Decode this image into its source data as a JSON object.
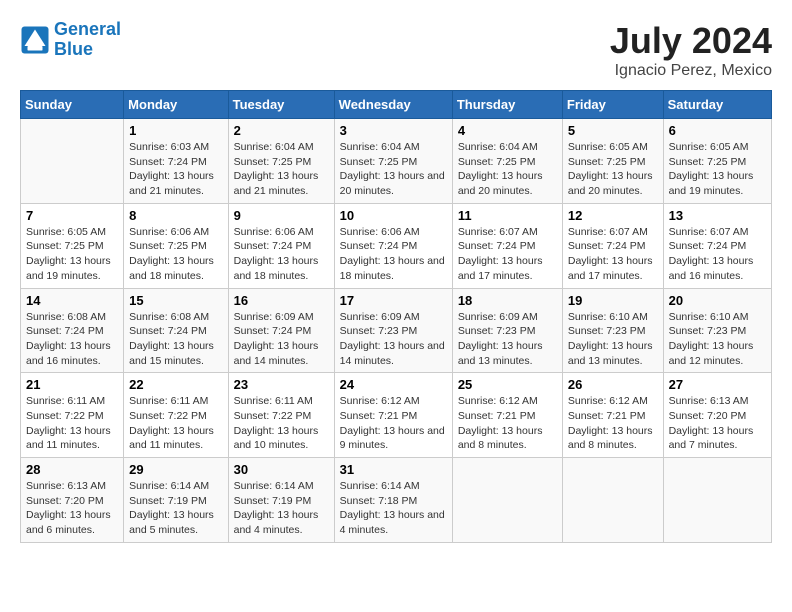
{
  "header": {
    "logo_line1": "General",
    "logo_line2": "Blue",
    "month_year": "July 2024",
    "location": "Ignacio Perez, Mexico"
  },
  "weekdays": [
    "Sunday",
    "Monday",
    "Tuesday",
    "Wednesday",
    "Thursday",
    "Friday",
    "Saturday"
  ],
  "weeks": [
    [
      {
        "day": "",
        "sunrise": "",
        "sunset": "",
        "daylight": ""
      },
      {
        "day": "1",
        "sunrise": "Sunrise: 6:03 AM",
        "sunset": "Sunset: 7:24 PM",
        "daylight": "Daylight: 13 hours and 21 minutes."
      },
      {
        "day": "2",
        "sunrise": "Sunrise: 6:04 AM",
        "sunset": "Sunset: 7:25 PM",
        "daylight": "Daylight: 13 hours and 21 minutes."
      },
      {
        "day": "3",
        "sunrise": "Sunrise: 6:04 AM",
        "sunset": "Sunset: 7:25 PM",
        "daylight": "Daylight: 13 hours and 20 minutes."
      },
      {
        "day": "4",
        "sunrise": "Sunrise: 6:04 AM",
        "sunset": "Sunset: 7:25 PM",
        "daylight": "Daylight: 13 hours and 20 minutes."
      },
      {
        "day": "5",
        "sunrise": "Sunrise: 6:05 AM",
        "sunset": "Sunset: 7:25 PM",
        "daylight": "Daylight: 13 hours and 20 minutes."
      },
      {
        "day": "6",
        "sunrise": "Sunrise: 6:05 AM",
        "sunset": "Sunset: 7:25 PM",
        "daylight": "Daylight: 13 hours and 19 minutes."
      }
    ],
    [
      {
        "day": "7",
        "sunrise": "Sunrise: 6:05 AM",
        "sunset": "Sunset: 7:25 PM",
        "daylight": "Daylight: 13 hours and 19 minutes."
      },
      {
        "day": "8",
        "sunrise": "Sunrise: 6:06 AM",
        "sunset": "Sunset: 7:25 PM",
        "daylight": "Daylight: 13 hours and 18 minutes."
      },
      {
        "day": "9",
        "sunrise": "Sunrise: 6:06 AM",
        "sunset": "Sunset: 7:24 PM",
        "daylight": "Daylight: 13 hours and 18 minutes."
      },
      {
        "day": "10",
        "sunrise": "Sunrise: 6:06 AM",
        "sunset": "Sunset: 7:24 PM",
        "daylight": "Daylight: 13 hours and 18 minutes."
      },
      {
        "day": "11",
        "sunrise": "Sunrise: 6:07 AM",
        "sunset": "Sunset: 7:24 PM",
        "daylight": "Daylight: 13 hours and 17 minutes."
      },
      {
        "day": "12",
        "sunrise": "Sunrise: 6:07 AM",
        "sunset": "Sunset: 7:24 PM",
        "daylight": "Daylight: 13 hours and 17 minutes."
      },
      {
        "day": "13",
        "sunrise": "Sunrise: 6:07 AM",
        "sunset": "Sunset: 7:24 PM",
        "daylight": "Daylight: 13 hours and 16 minutes."
      }
    ],
    [
      {
        "day": "14",
        "sunrise": "Sunrise: 6:08 AM",
        "sunset": "Sunset: 7:24 PM",
        "daylight": "Daylight: 13 hours and 16 minutes."
      },
      {
        "day": "15",
        "sunrise": "Sunrise: 6:08 AM",
        "sunset": "Sunset: 7:24 PM",
        "daylight": "Daylight: 13 hours and 15 minutes."
      },
      {
        "day": "16",
        "sunrise": "Sunrise: 6:09 AM",
        "sunset": "Sunset: 7:24 PM",
        "daylight": "Daylight: 13 hours and 14 minutes."
      },
      {
        "day": "17",
        "sunrise": "Sunrise: 6:09 AM",
        "sunset": "Sunset: 7:23 PM",
        "daylight": "Daylight: 13 hours and 14 minutes."
      },
      {
        "day": "18",
        "sunrise": "Sunrise: 6:09 AM",
        "sunset": "Sunset: 7:23 PM",
        "daylight": "Daylight: 13 hours and 13 minutes."
      },
      {
        "day": "19",
        "sunrise": "Sunrise: 6:10 AM",
        "sunset": "Sunset: 7:23 PM",
        "daylight": "Daylight: 13 hours and 13 minutes."
      },
      {
        "day": "20",
        "sunrise": "Sunrise: 6:10 AM",
        "sunset": "Sunset: 7:23 PM",
        "daylight": "Daylight: 13 hours and 12 minutes."
      }
    ],
    [
      {
        "day": "21",
        "sunrise": "Sunrise: 6:11 AM",
        "sunset": "Sunset: 7:22 PM",
        "daylight": "Daylight: 13 hours and 11 minutes."
      },
      {
        "day": "22",
        "sunrise": "Sunrise: 6:11 AM",
        "sunset": "Sunset: 7:22 PM",
        "daylight": "Daylight: 13 hours and 11 minutes."
      },
      {
        "day": "23",
        "sunrise": "Sunrise: 6:11 AM",
        "sunset": "Sunset: 7:22 PM",
        "daylight": "Daylight: 13 hours and 10 minutes."
      },
      {
        "day": "24",
        "sunrise": "Sunrise: 6:12 AM",
        "sunset": "Sunset: 7:21 PM",
        "daylight": "Daylight: 13 hours and 9 minutes."
      },
      {
        "day": "25",
        "sunrise": "Sunrise: 6:12 AM",
        "sunset": "Sunset: 7:21 PM",
        "daylight": "Daylight: 13 hours and 8 minutes."
      },
      {
        "day": "26",
        "sunrise": "Sunrise: 6:12 AM",
        "sunset": "Sunset: 7:21 PM",
        "daylight": "Daylight: 13 hours and 8 minutes."
      },
      {
        "day": "27",
        "sunrise": "Sunrise: 6:13 AM",
        "sunset": "Sunset: 7:20 PM",
        "daylight": "Daylight: 13 hours and 7 minutes."
      }
    ],
    [
      {
        "day": "28",
        "sunrise": "Sunrise: 6:13 AM",
        "sunset": "Sunset: 7:20 PM",
        "daylight": "Daylight: 13 hours and 6 minutes."
      },
      {
        "day": "29",
        "sunrise": "Sunrise: 6:14 AM",
        "sunset": "Sunset: 7:19 PM",
        "daylight": "Daylight: 13 hours and 5 minutes."
      },
      {
        "day": "30",
        "sunrise": "Sunrise: 6:14 AM",
        "sunset": "Sunset: 7:19 PM",
        "daylight": "Daylight: 13 hours and 4 minutes."
      },
      {
        "day": "31",
        "sunrise": "Sunrise: 6:14 AM",
        "sunset": "Sunset: 7:18 PM",
        "daylight": "Daylight: 13 hours and 4 minutes."
      },
      {
        "day": "",
        "sunrise": "",
        "sunset": "",
        "daylight": ""
      },
      {
        "day": "",
        "sunrise": "",
        "sunset": "",
        "daylight": ""
      },
      {
        "day": "",
        "sunrise": "",
        "sunset": "",
        "daylight": ""
      }
    ]
  ]
}
